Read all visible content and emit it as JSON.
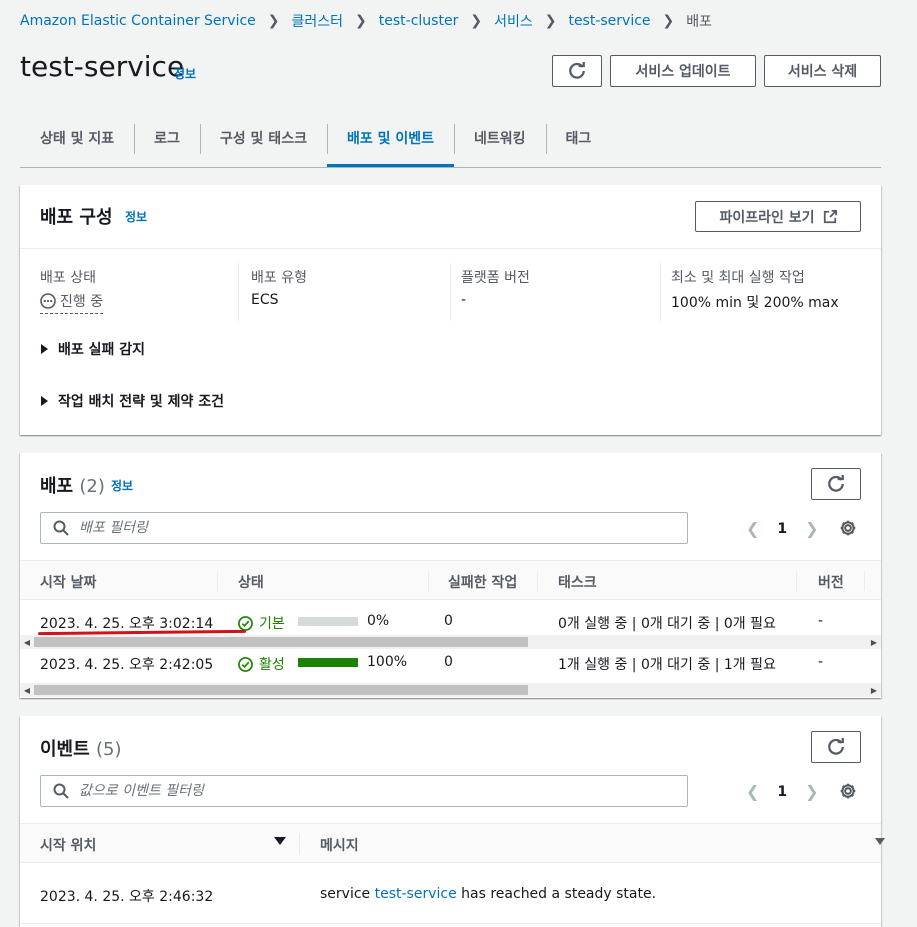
{
  "breadcrumb": {
    "items": [
      "Amazon Elastic Container Service",
      "클러스터",
      "test-cluster",
      "서비스",
      "test-service"
    ],
    "current": "배포"
  },
  "page": {
    "title": "test-service",
    "info": "정보",
    "refresh_icon": "refresh-icon",
    "update_button": "서비스 업데이트",
    "delete_button": "서비스 삭제"
  },
  "tabs": [
    {
      "label": "상태 및 지표",
      "active": false
    },
    {
      "label": "로그",
      "active": false
    },
    {
      "label": "구성 및 태스크",
      "active": false
    },
    {
      "label": "배포 및 이벤트",
      "active": true
    },
    {
      "label": "네트워킹",
      "active": false
    },
    {
      "label": "태그",
      "active": false
    }
  ],
  "deploy_config": {
    "title": "배포 구성",
    "info": "정보",
    "pipeline_button": "파이프라인 보기",
    "fields": [
      {
        "label": "배포 상태",
        "value": "진행 중"
      },
      {
        "label": "배포 유형",
        "value": "ECS"
      },
      {
        "label": "플랫폼 버전",
        "value": "-"
      },
      {
        "label": "최소 및 최대 실행 작업",
        "value": "100% min 및 200% max"
      }
    ],
    "expanders": [
      "배포 실패 감지",
      "작업 배치 전략 및 제약 조건"
    ]
  },
  "deployments": {
    "title": "배포",
    "count": "(2)",
    "info": "정보",
    "filter_placeholder": "배포 필터링",
    "page": "1",
    "columns": [
      "시작 날짜",
      "상태",
      "실패한 작업",
      "태스크",
      "버전"
    ],
    "rows": [
      {
        "start": "2023. 4. 25. 오후 3:02:14",
        "status": "기본",
        "progress": 0,
        "progress_label": "0%",
        "failed": "0",
        "tasks": "0개 실행 중 | 0개 대기 중 | 0개 필요",
        "version": "-"
      },
      {
        "start": "2023. 4. 25. 오후 2:42:05",
        "status": "활성",
        "progress": 100,
        "progress_label": "100%",
        "failed": "0",
        "tasks": "1개 실행 중 | 0개 대기 중 | 1개 필요",
        "version": "-"
      }
    ]
  },
  "events": {
    "title": "이벤트",
    "count": "(5)",
    "filter_placeholder": "값으로 이벤트 필터링",
    "page": "1",
    "columns": [
      "시작 위치",
      "메시지"
    ],
    "rows": [
      {
        "time": "2023. 4. 25. 오후 2:46:32",
        "msg_prefix": "service ",
        "msg_link": "test-service",
        "msg_suffix": " has reached a steady state."
      }
    ]
  },
  "colors": {
    "link": "#0073bb",
    "success": "#1d8102",
    "annotation": "#d0121a"
  }
}
